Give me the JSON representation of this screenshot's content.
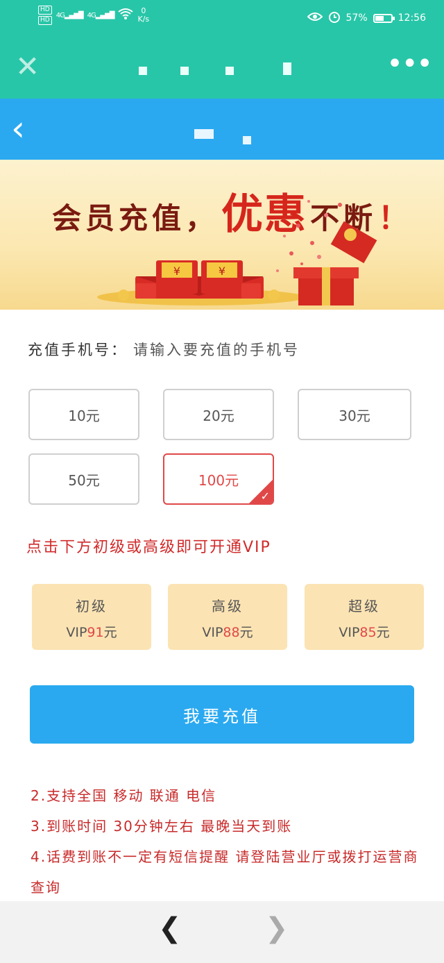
{
  "status_bar": {
    "hd1": "HD",
    "hd2": "HD",
    "signal1": "4G",
    "signal2": "4G",
    "speed_value": "0",
    "speed_unit": "K/s",
    "battery_percent": "57%",
    "battery_level": 0.57,
    "time": "12:56"
  },
  "banner": {
    "title_part1": "会员充值，",
    "title_part2": "优惠",
    "title_part3": "不断",
    "title_part4": "！"
  },
  "form": {
    "phone_label": "充值手机号：",
    "phone_placeholder": "请输入要充值的手机号",
    "amounts": [
      "10元",
      "20元",
      "30元",
      "50元",
      "100元"
    ],
    "selected_amount": "100元"
  },
  "promo_text": "点击下方初级或高级即可开通VIP",
  "vip_levels": [
    {
      "name": "初级",
      "prefix": "VIP",
      "price": "91",
      "suffix": "元"
    },
    {
      "name": "高级",
      "prefix": "VIP",
      "price": "88",
      "suffix": "元"
    },
    {
      "name": "超级",
      "prefix": "VIP",
      "price": "85",
      "suffix": "元"
    }
  ],
  "recharge_button": "我要充值",
  "notes": [
    "2.支持全国 移动 联通 电信",
    "3.到账时间 30分钟左右 最晚当天到账",
    "4.话费到账不一定有短信提醒 请登陆营业厅或拨打运营商查询"
  ],
  "colors": {
    "app_bar": "#28c6a8",
    "header": "#2aa9f0",
    "accent_red": "#e04848",
    "vip_card": "#fbe3b3"
  }
}
